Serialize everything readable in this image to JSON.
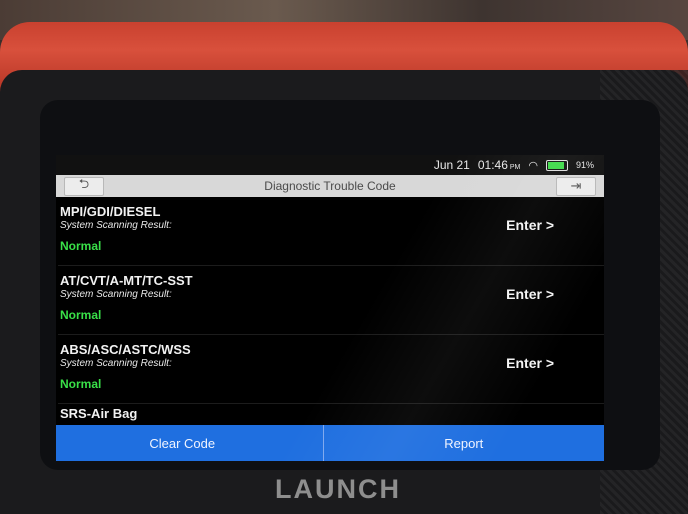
{
  "device": {
    "brand": "LAUNCH"
  },
  "status_bar": {
    "date": "Jun 21",
    "time": "01:46",
    "ampm": "PM",
    "battery_percent": "91%",
    "battery_level": 0.91,
    "wifi_icon": "wifi-icon"
  },
  "header": {
    "title": "Diagnostic Trouble Code",
    "back_icon": "back-arrow-icon",
    "exit_icon": "exit-icon"
  },
  "systems": [
    {
      "name": "MPI/GDI/DIESEL",
      "label": "System Scanning Result:",
      "status": "Normal",
      "action": "Enter >"
    },
    {
      "name": "AT/CVT/A-MT/TC-SST",
      "label": "System Scanning Result:",
      "status": "Normal",
      "action": "Enter >"
    },
    {
      "name": "ABS/ASC/ASTC/WSS",
      "label": "System Scanning Result:",
      "status": "Normal",
      "action": "Enter >"
    },
    {
      "name": "SRS-Air Bag"
    }
  ],
  "footer": {
    "clear_code_label": "Clear Code",
    "report_label": "Report"
  },
  "colors": {
    "accent_blue": "#1f6fe0",
    "status_green": "#39e048",
    "bezel_red": "#d8503c"
  }
}
